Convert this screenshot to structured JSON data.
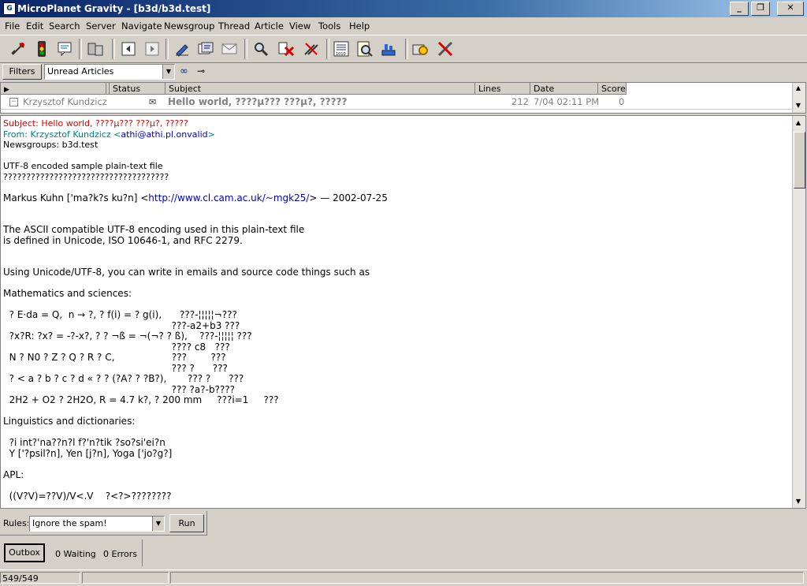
{
  "window": {
    "title": "MicroPlanet Gravity - [b3d/b3d.test]",
    "icon_letter": "G"
  },
  "menu": [
    "File",
    "Edit",
    "Search",
    "Server",
    "Navigate",
    "Newsgroup",
    "Thread",
    "Article",
    "View",
    "Tools",
    "Help"
  ],
  "toolbar_icons": [
    "connect-icon",
    "traffic-light-icon",
    "post-icon",
    "servers-icon",
    "prev-icon",
    "next-icon",
    "sign-icon",
    "newsgroups-icon",
    "mail-icon",
    "search-icon",
    "delete-icon",
    "tag-icon",
    "binary-icon",
    "inspect-icon",
    "filter-icon",
    "options-icon",
    "tools-icon"
  ],
  "filters": {
    "button_label": "Filters",
    "selected": "Unread Articles"
  },
  "list": {
    "columns": [
      "",
      "Status",
      "Subject",
      "Lines",
      "Date",
      "Score"
    ],
    "rows": [
      {
        "from": "Krzysztof Kundzicz",
        "subject": "Hello world, ????μ??? ???μ?, ?????",
        "lines": "212",
        "date": "7/04 02:11 PM",
        "score": "0"
      }
    ]
  },
  "message": {
    "subject": "Subject: Hello world, ????μ??? ???μ?, ?????",
    "from_label": "From: Krzysztof Kundzicz <",
    "from_email": "athi@athi.pl.onvalid",
    "from_end": ">",
    "newsgroups": "Newsgroups: b3d.test",
    "body_intro": [
      "",
      "UTF-8 encoded sample plain-text file",
      "????????????????????????????????????",
      ""
    ],
    "author_pre": "Markus Kuhn ['ma?k?s ku?n] <",
    "author_url": "http://www.cl.cam.ac.uk/~mgk25/",
    "author_post": "> — 2002-07-25",
    "body": [
      "",
      "",
      "The ASCII compatible UTF-8 encoding used in this plain-text file",
      "is defined in Unicode, ISO 10646-1, and RFC 2279.",
      "",
      "",
      "Using Unicode/UTF-8, you can write in emails and source code things such as",
      "",
      "Mathematics and sciences:",
      "",
      "  ? E·da = Q,  n → ?, ? f(i) = ? g(i),      ???-¦¦¦¦¦¬???",
      "                                                        ???-a2+b3 ???",
      "  ?x?R: ?x? = -?-x?, ? ? ¬ß = ¬(¬? ? ß),    ???-¦¦¦¦¦ ???",
      "                                                        ???? c8   ???",
      "  N ? N0 ? Z ? Q ? R ? C,                   ???        ???",
      "                                                        ??? ?      ???",
      "  ? < a ? b ? c ? d « ? ? (?A? ? ?B?),       ??? ?      ???",
      "                                                        ??? ?a?-b????",
      "  2H2 + O2 ? 2H2O, R = 4.7 k?, ? 200 mm     ???i=1     ???",
      "",
      "Linguistics and dictionaries:",
      "",
      "  ?i int?'na??n?l f?'n?tik ?so?si'ei?n",
      "  Y ['?psil?n], Yen [j?n], Yoga ['jo?g?]",
      "",
      "APL:",
      "",
      "  ((V?V)=??V)/V<.V    ?<?>????????"
    ]
  },
  "rules": {
    "label": "Rules:",
    "selected": "Ignore the spam!",
    "run_label": "Run"
  },
  "outbox": {
    "button_label": "Outbox",
    "waiting": "0 Waiting",
    "errors": "0 Errors"
  },
  "status": {
    "count": "549/549"
  }
}
